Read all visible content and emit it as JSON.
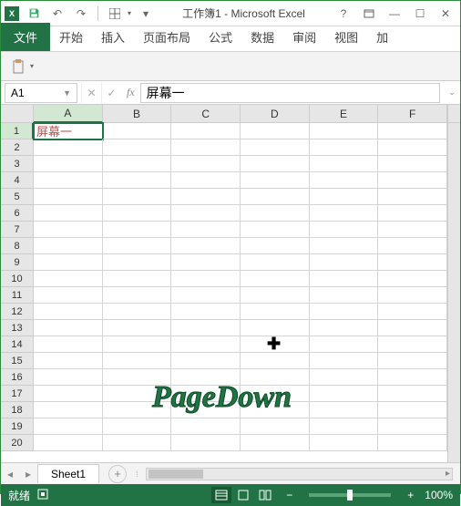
{
  "titlebar": {
    "title": "工作簿1 - Microsoft Excel"
  },
  "ribbon": {
    "file": "文件",
    "tabs": [
      "开始",
      "插入",
      "页面布局",
      "公式",
      "数据",
      "审阅",
      "视图",
      "加"
    ]
  },
  "formula_bar": {
    "name_box": "A1",
    "fx": "fx",
    "value": "屏幕一"
  },
  "columns": [
    "A",
    "B",
    "C",
    "D",
    "E",
    "F"
  ],
  "rows": [
    1,
    2,
    3,
    4,
    5,
    6,
    7,
    8,
    9,
    10,
    11,
    12,
    13,
    14,
    15,
    16,
    17,
    18,
    19,
    20
  ],
  "active_cell": {
    "row": 1,
    "col": "A",
    "value": "屏幕一"
  },
  "sheet_tabs": {
    "active": "Sheet1"
  },
  "statusbar": {
    "ready": "就绪",
    "zoom": "100%"
  },
  "overlay": {
    "text": "PageDown"
  },
  "chart_data": {
    "type": "table",
    "title": "工作簿1",
    "columns": [
      "A",
      "B",
      "C",
      "D",
      "E",
      "F"
    ],
    "rows_shown": 20,
    "cells": {
      "A1": "屏幕一"
    },
    "selected": "A1"
  }
}
